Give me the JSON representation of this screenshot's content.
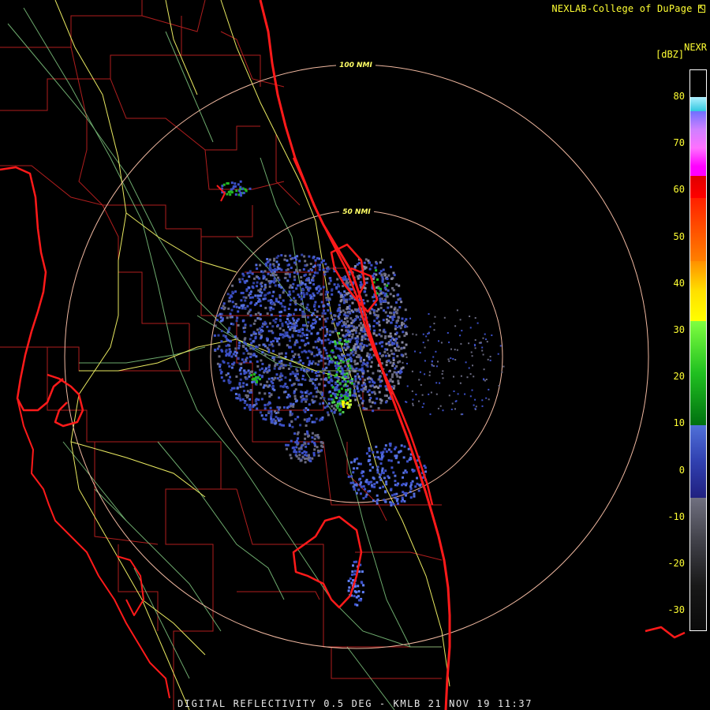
{
  "header": {
    "credit": "NEXLAB-College of DuPage",
    "credit_icon": "cursor-arrow-icon",
    "product": "NEXR",
    "units": "[dBZ]"
  },
  "colorbar": {
    "ticks": [
      "80",
      "70",
      "60",
      "50",
      "40",
      "30",
      "20",
      "10",
      "0",
      "-10",
      "-20",
      "-30"
    ],
    "colors": {
      "dark_gray": "#1a1a1a",
      "gray": "#6a6a80",
      "blue": "#3c50c8",
      "green": "#22b822",
      "yellow": "#ffff00",
      "orange": "#ff8c00",
      "red": "#ff0000",
      "magenta": "#ff00ff",
      "cyan": "#22d0e0"
    }
  },
  "range_rings": {
    "outer_label": "100 NMI",
    "inner_label": "50 NMI"
  },
  "map_colors": {
    "coastline": "#ff1a1a",
    "county_lines": "#b01e1e",
    "highways": "#e8e860",
    "roads": "#80c880",
    "rings": "#f0b8a0"
  },
  "footer": {
    "caption": "DIGITAL REFLECTIVITY 0.5 DEG - KMLB 21 NOV 19 11:37"
  }
}
